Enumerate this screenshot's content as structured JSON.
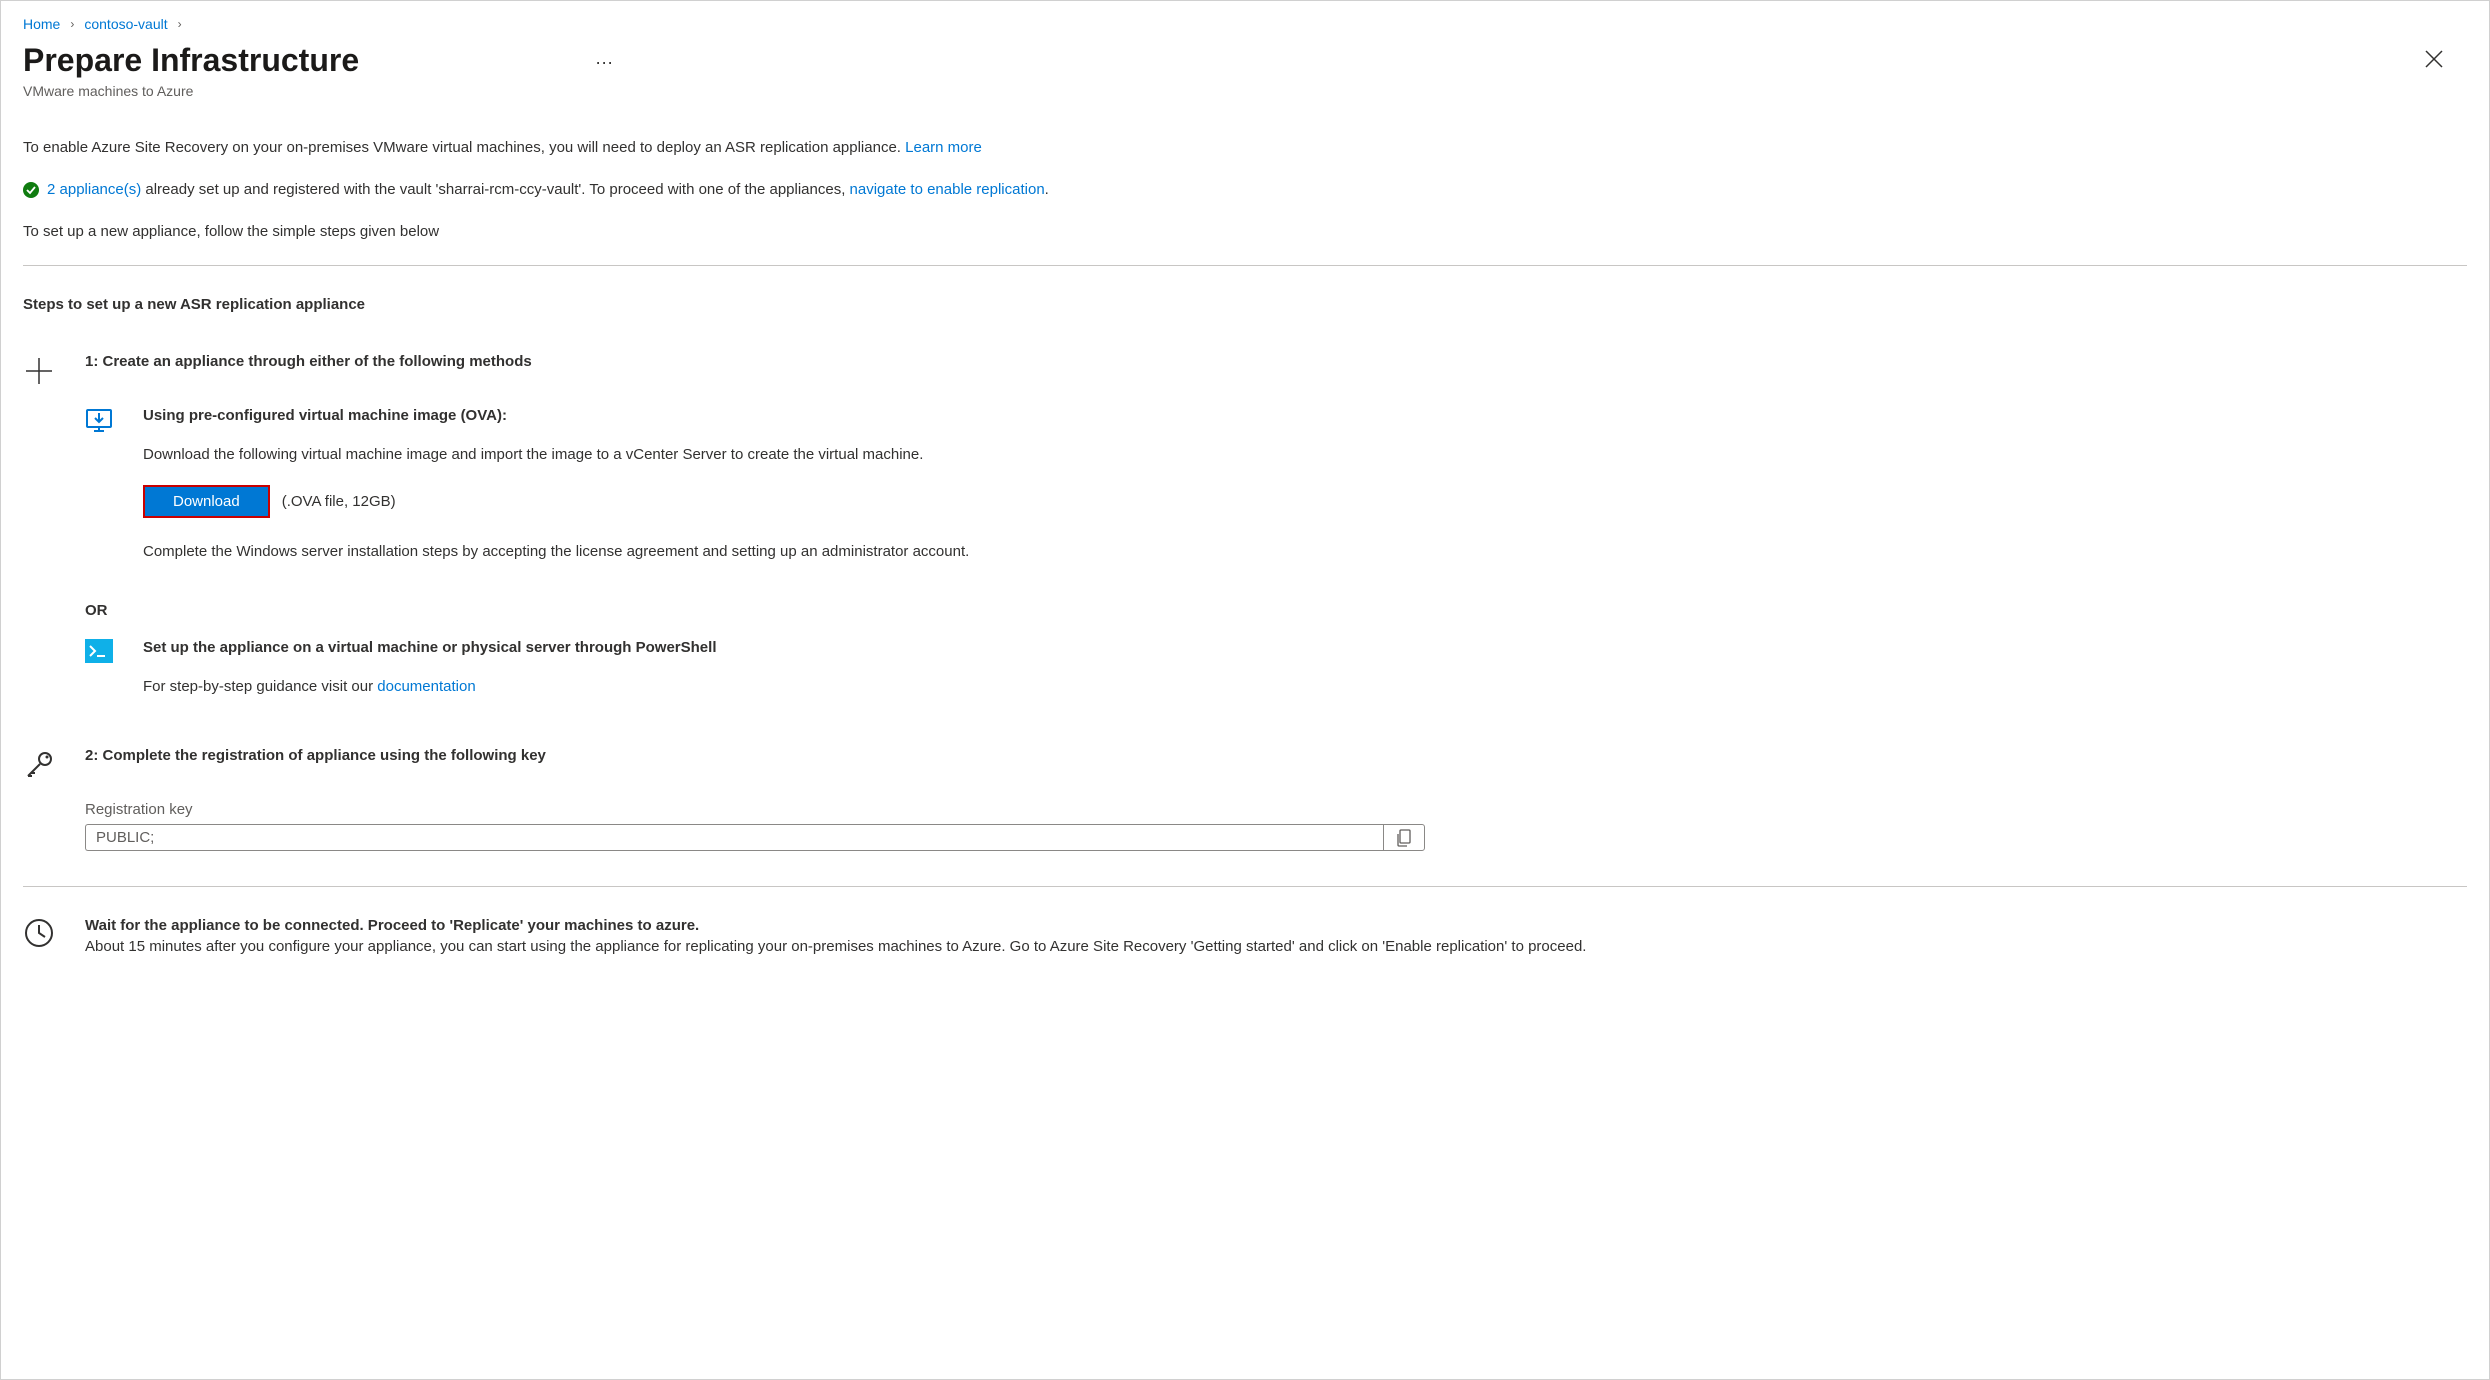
{
  "breadcrumb": {
    "home": "Home",
    "vault": "contoso-vault"
  },
  "header": {
    "title": "Prepare Infrastructure",
    "subtitle": "VMware machines to Azure"
  },
  "intro": {
    "text_before_link": "To enable Azure Site Recovery on your on-premises VMware virtual machines, you will need to deploy an ASR replication appliance. ",
    "learn_more": "Learn more"
  },
  "status": {
    "appliances_link": "2 appliance(s)",
    "vault_text_before": " already set up and registered with the vault 'sharrai-rcm-ccy-vault'. To proceed with one of the appliances, ",
    "nav_link": "navigate to enable replication",
    "period": "."
  },
  "setup_hint": "To set up a new appliance, follow the simple steps given below",
  "section_heading": "Steps to set up a new ASR replication appliance",
  "step1": {
    "title": "1: Create an appliance through either of the following methods",
    "method_ova": {
      "title": "Using pre-configured virtual machine image (OVA):",
      "body": "Download the following virtual machine image and import the image to a vCenter Server to create the virtual machine.",
      "download_label": "Download",
      "download_hint": "(.OVA file, 12GB)",
      "complete_text": "Complete the Windows server installation steps by accepting the license agreement and setting up an administrator account."
    },
    "or_label": "OR",
    "method_ps": {
      "title": "Set up the appliance on a virtual machine or physical server through PowerShell",
      "guidance_prefix": "For step-by-step guidance visit our ",
      "doc_link": "documentation"
    }
  },
  "step2": {
    "title": "2: Complete the registration of appliance using the following key",
    "reg_label": "Registration key",
    "reg_value": "PUBLIC;"
  },
  "footer": {
    "title": "Wait for the appliance to be connected. Proceed to 'Replicate' your machines to azure.",
    "body": "About 15 minutes after you configure your appliance, you can start using the appliance for replicating your on-premises machines to Azure. Go to Azure Site Recovery 'Getting started' and click on 'Enable replication' to proceed."
  }
}
